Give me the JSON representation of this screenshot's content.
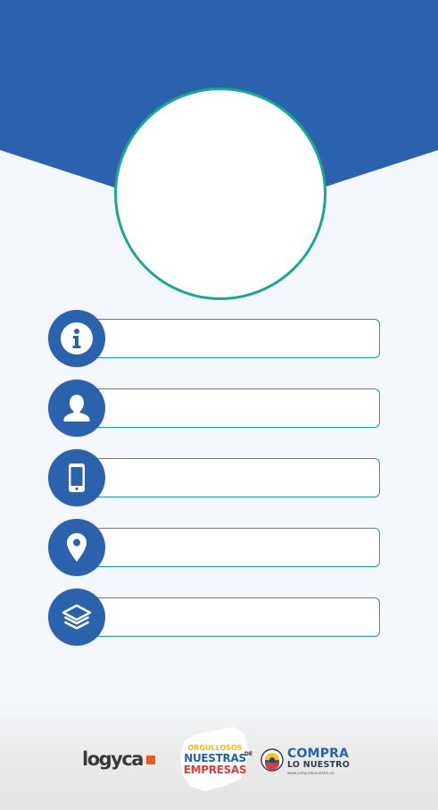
{
  "colors": {
    "header_blue": "#2a62ad",
    "page_background": "#f4f7fb",
    "accent_teal": "#18a58d",
    "icon_circle": "#2a62ad"
  },
  "profile": {
    "avatar_icon": "avatar-placeholder"
  },
  "fields": [
    {
      "icon": "info-icon",
      "value": ""
    },
    {
      "icon": "person-icon",
      "value": ""
    },
    {
      "icon": "phone-icon",
      "value": ""
    },
    {
      "icon": "location-pin-icon",
      "value": ""
    },
    {
      "icon": "layers-icon",
      "value": ""
    }
  ],
  "footer": {
    "logos": {
      "logyca": "logyca",
      "orgullosos_line1": "ORGULLOSOS",
      "orgullosos_de": "DE",
      "orgullosos_line2": "NUESTRAS",
      "orgullosos_line3": "EMPRESAS",
      "compra_line1": "COMPRA",
      "compra_line2": "LO NUESTRO",
      "compra_url": "www.compralonuestro.co"
    }
  }
}
